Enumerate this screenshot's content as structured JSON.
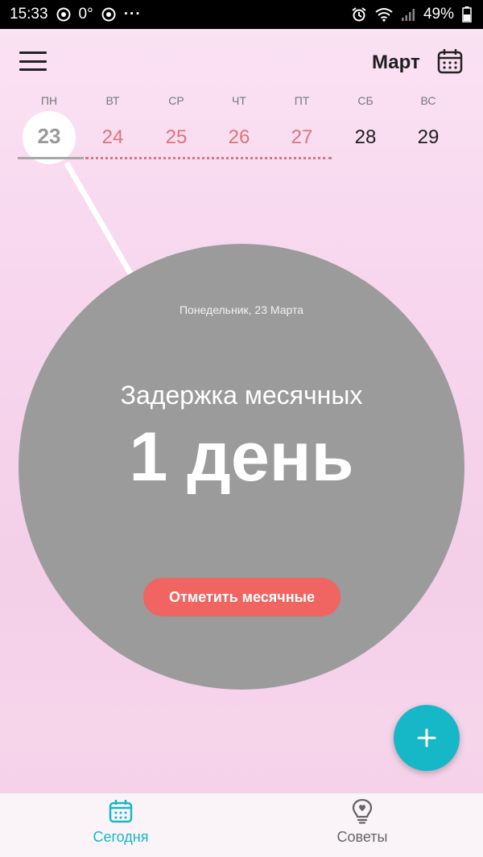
{
  "status_bar": {
    "time": "15:33",
    "temperature": "0°",
    "more": "···",
    "battery": "49%"
  },
  "header": {
    "month": "Март"
  },
  "week": [
    {
      "name": "ПН",
      "number": "23",
      "state": "selected"
    },
    {
      "name": "ВТ",
      "number": "24",
      "state": "period"
    },
    {
      "name": "СР",
      "number": "25",
      "state": "period"
    },
    {
      "name": "ЧТ",
      "number": "26",
      "state": "period"
    },
    {
      "name": "ПТ",
      "number": "27",
      "state": "period"
    },
    {
      "name": "СБ",
      "number": "28",
      "state": "normal"
    },
    {
      "name": "ВС",
      "number": "29",
      "state": "normal"
    }
  ],
  "main": {
    "date": "Понедельник, 23 Марта",
    "delay_label": "Задержка месячных",
    "delay_value": "1 день",
    "mark_button": "Отметить месячные"
  },
  "bottom_nav": [
    {
      "label": "Сегодня",
      "icon": "calendar-icon",
      "active": true
    },
    {
      "label": "Советы",
      "icon": "lightbulb-heart-icon",
      "active": false
    }
  ],
  "colors": {
    "accent": "#16b8c8",
    "period": "#e0737c",
    "button": "#f06461",
    "circle": "#9b9b9b"
  }
}
